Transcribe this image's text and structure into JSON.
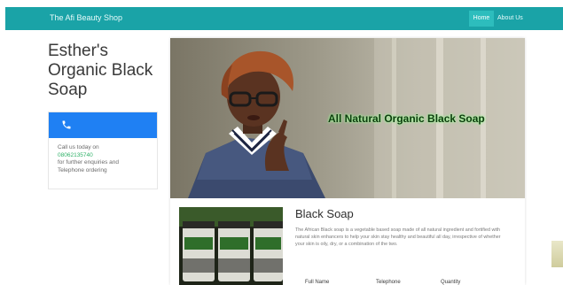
{
  "navbar": {
    "brand": "The Afi Beauty Shop",
    "links": [
      "Home",
      "About Us"
    ]
  },
  "page_title": "Esther's Organic Black Soap",
  "call_card": {
    "icon": "phone-icon",
    "line1": "Call us today on",
    "phone": "08062135740",
    "line2": "for further enquiries and",
    "line3": "Telephone ordering"
  },
  "hero": {
    "overlay_text": "All Natural Organic Black Soap"
  },
  "product": {
    "title": "Black Soap",
    "description": "The African Black soap is a vegetable based soap made of all natural ingredient and fortified with natural skin enhancers to help your skin stay healthy and beautiful all day, irrespective of whether your skin is oily, dry, or a combination of the two.",
    "columns": [
      "Full Name",
      "Telephone",
      "Quantity"
    ]
  },
  "colors": {
    "navbar": "#1aa3a7",
    "call_header": "#1f80f3",
    "phone_text": "#32b26a",
    "hero_text_glow": "#8ef08a"
  }
}
